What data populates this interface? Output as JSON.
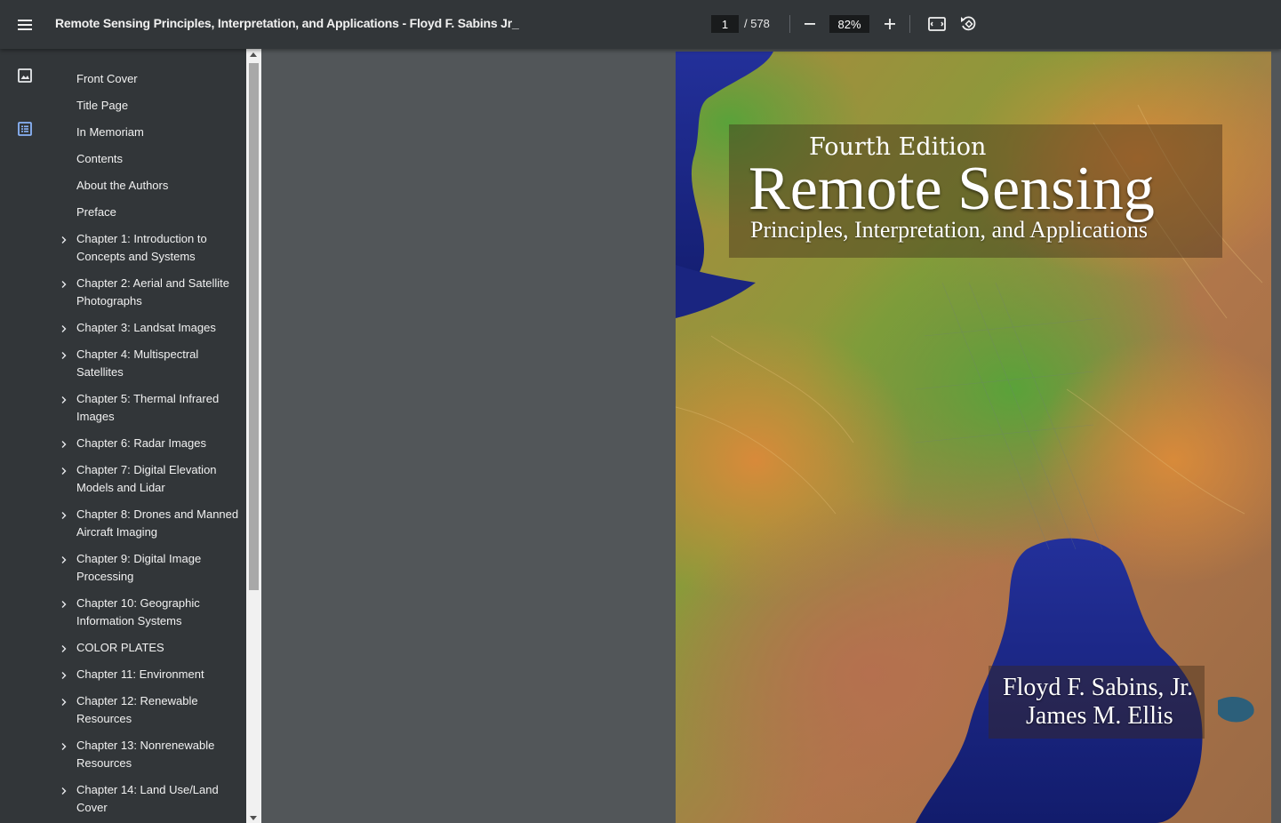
{
  "toolbar": {
    "title": "Remote Sensing Principles, Interpretation, and Applications - Floyd F. Sabins Jr_",
    "page_current": "1",
    "page_total": "/ 578",
    "zoom": "82%",
    "icons": [
      "menu-icon",
      "zoom-out-icon",
      "zoom-in-icon",
      "fit-page-icon",
      "rotate-icon"
    ]
  },
  "rail": {
    "icons": [
      "thumbnail-icon",
      "outline-icon"
    ]
  },
  "outline": [
    {
      "label": "Front Cover",
      "expandable": false
    },
    {
      "label": "Title Page",
      "expandable": false
    },
    {
      "label": "In Memoriam",
      "expandable": false
    },
    {
      "label": "Contents",
      "expandable": false
    },
    {
      "label": "About the Authors",
      "expandable": false
    },
    {
      "label": "Preface",
      "expandable": false
    },
    {
      "label": "Chapter 1: Introduction to Concepts and Systems",
      "expandable": true
    },
    {
      "label": "Chapter 2: Aerial and Satellite Photographs",
      "expandable": true
    },
    {
      "label": "Chapter 3: Landsat Images",
      "expandable": true
    },
    {
      "label": "Chapter 4: Multispectral Satellites",
      "expandable": true
    },
    {
      "label": "Chapter 5: Thermal Infrared Images",
      "expandable": true
    },
    {
      "label": "Chapter 6: Radar Images",
      "expandable": true
    },
    {
      "label": "Chapter 7: Digital Elevation Models and Lidar",
      "expandable": true
    },
    {
      "label": "Chapter 8: Drones and Manned Aircraft Imaging",
      "expandable": true
    },
    {
      "label": "Chapter 9: Digital Image Processing",
      "expandable": true
    },
    {
      "label": "Chapter 10: Geographic Information Systems",
      "expandable": true
    },
    {
      "label": "COLOR PLATES",
      "expandable": true
    },
    {
      "label": "Chapter 11: Environment",
      "expandable": true
    },
    {
      "label": "Chapter 12: Renewable Resources",
      "expandable": true
    },
    {
      "label": "Chapter 13: Nonrenewable Resources",
      "expandable": true
    },
    {
      "label": "Chapter 14: Land Use/Land Cover",
      "expandable": true
    }
  ],
  "cover": {
    "edition": "Fourth Edition",
    "title": "Remote Sensing",
    "subtitle": "Principles, Interpretation, and Applications",
    "author1": "Floyd F. Sabins, Jr.",
    "author2": "James M. Ellis"
  },
  "colors": {
    "toolbar_bg": "#323639",
    "viewer_bg": "#525659",
    "accent": "#8ab4f8",
    "lake": "#1e2a8c"
  }
}
